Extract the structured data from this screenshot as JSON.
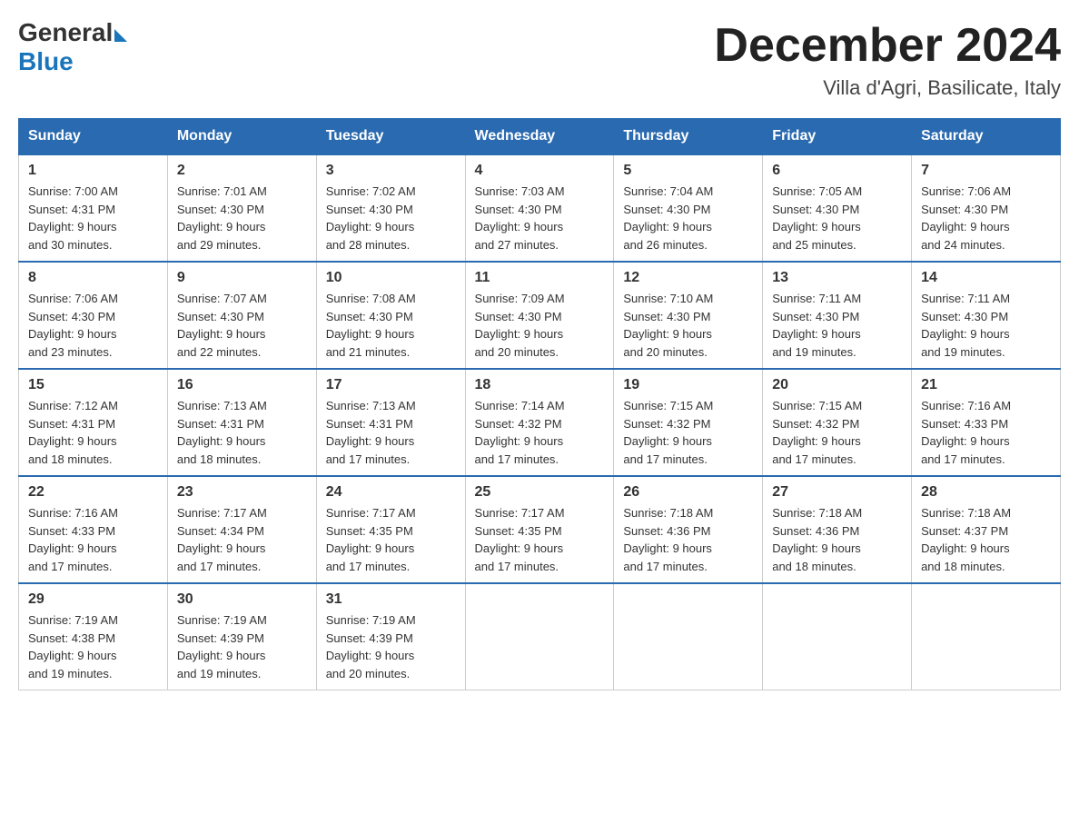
{
  "header": {
    "logo_general": "General",
    "logo_blue": "Blue",
    "month_title": "December 2024",
    "location": "Villa d'Agri, Basilicate, Italy"
  },
  "weekdays": [
    "Sunday",
    "Monday",
    "Tuesday",
    "Wednesday",
    "Thursday",
    "Friday",
    "Saturday"
  ],
  "weeks": [
    [
      {
        "day": "1",
        "sunrise": "7:00 AM",
        "sunset": "4:31 PM",
        "daylight": "9 hours and 30 minutes."
      },
      {
        "day": "2",
        "sunrise": "7:01 AM",
        "sunset": "4:30 PM",
        "daylight": "9 hours and 29 minutes."
      },
      {
        "day": "3",
        "sunrise": "7:02 AM",
        "sunset": "4:30 PM",
        "daylight": "9 hours and 28 minutes."
      },
      {
        "day": "4",
        "sunrise": "7:03 AM",
        "sunset": "4:30 PM",
        "daylight": "9 hours and 27 minutes."
      },
      {
        "day": "5",
        "sunrise": "7:04 AM",
        "sunset": "4:30 PM",
        "daylight": "9 hours and 26 minutes."
      },
      {
        "day": "6",
        "sunrise": "7:05 AM",
        "sunset": "4:30 PM",
        "daylight": "9 hours and 25 minutes."
      },
      {
        "day": "7",
        "sunrise": "7:06 AM",
        "sunset": "4:30 PM",
        "daylight": "9 hours and 24 minutes."
      }
    ],
    [
      {
        "day": "8",
        "sunrise": "7:06 AM",
        "sunset": "4:30 PM",
        "daylight": "9 hours and 23 minutes."
      },
      {
        "day": "9",
        "sunrise": "7:07 AM",
        "sunset": "4:30 PM",
        "daylight": "9 hours and 22 minutes."
      },
      {
        "day": "10",
        "sunrise": "7:08 AM",
        "sunset": "4:30 PM",
        "daylight": "9 hours and 21 minutes."
      },
      {
        "day": "11",
        "sunrise": "7:09 AM",
        "sunset": "4:30 PM",
        "daylight": "9 hours and 20 minutes."
      },
      {
        "day": "12",
        "sunrise": "7:10 AM",
        "sunset": "4:30 PM",
        "daylight": "9 hours and 20 minutes."
      },
      {
        "day": "13",
        "sunrise": "7:11 AM",
        "sunset": "4:30 PM",
        "daylight": "9 hours and 19 minutes."
      },
      {
        "day": "14",
        "sunrise": "7:11 AM",
        "sunset": "4:30 PM",
        "daylight": "9 hours and 19 minutes."
      }
    ],
    [
      {
        "day": "15",
        "sunrise": "7:12 AM",
        "sunset": "4:31 PM",
        "daylight": "9 hours and 18 minutes."
      },
      {
        "day": "16",
        "sunrise": "7:13 AM",
        "sunset": "4:31 PM",
        "daylight": "9 hours and 18 minutes."
      },
      {
        "day": "17",
        "sunrise": "7:13 AM",
        "sunset": "4:31 PM",
        "daylight": "9 hours and 17 minutes."
      },
      {
        "day": "18",
        "sunrise": "7:14 AM",
        "sunset": "4:32 PM",
        "daylight": "9 hours and 17 minutes."
      },
      {
        "day": "19",
        "sunrise": "7:15 AM",
        "sunset": "4:32 PM",
        "daylight": "9 hours and 17 minutes."
      },
      {
        "day": "20",
        "sunrise": "7:15 AM",
        "sunset": "4:32 PM",
        "daylight": "9 hours and 17 minutes."
      },
      {
        "day": "21",
        "sunrise": "7:16 AM",
        "sunset": "4:33 PM",
        "daylight": "9 hours and 17 minutes."
      }
    ],
    [
      {
        "day": "22",
        "sunrise": "7:16 AM",
        "sunset": "4:33 PM",
        "daylight": "9 hours and 17 minutes."
      },
      {
        "day": "23",
        "sunrise": "7:17 AM",
        "sunset": "4:34 PM",
        "daylight": "9 hours and 17 minutes."
      },
      {
        "day": "24",
        "sunrise": "7:17 AM",
        "sunset": "4:35 PM",
        "daylight": "9 hours and 17 minutes."
      },
      {
        "day": "25",
        "sunrise": "7:17 AM",
        "sunset": "4:35 PM",
        "daylight": "9 hours and 17 minutes."
      },
      {
        "day": "26",
        "sunrise": "7:18 AM",
        "sunset": "4:36 PM",
        "daylight": "9 hours and 17 minutes."
      },
      {
        "day": "27",
        "sunrise": "7:18 AM",
        "sunset": "4:36 PM",
        "daylight": "9 hours and 18 minutes."
      },
      {
        "day": "28",
        "sunrise": "7:18 AM",
        "sunset": "4:37 PM",
        "daylight": "9 hours and 18 minutes."
      }
    ],
    [
      {
        "day": "29",
        "sunrise": "7:19 AM",
        "sunset": "4:38 PM",
        "daylight": "9 hours and 19 minutes."
      },
      {
        "day": "30",
        "sunrise": "7:19 AM",
        "sunset": "4:39 PM",
        "daylight": "9 hours and 19 minutes."
      },
      {
        "day": "31",
        "sunrise": "7:19 AM",
        "sunset": "4:39 PM",
        "daylight": "9 hours and 20 minutes."
      },
      null,
      null,
      null,
      null
    ]
  ]
}
